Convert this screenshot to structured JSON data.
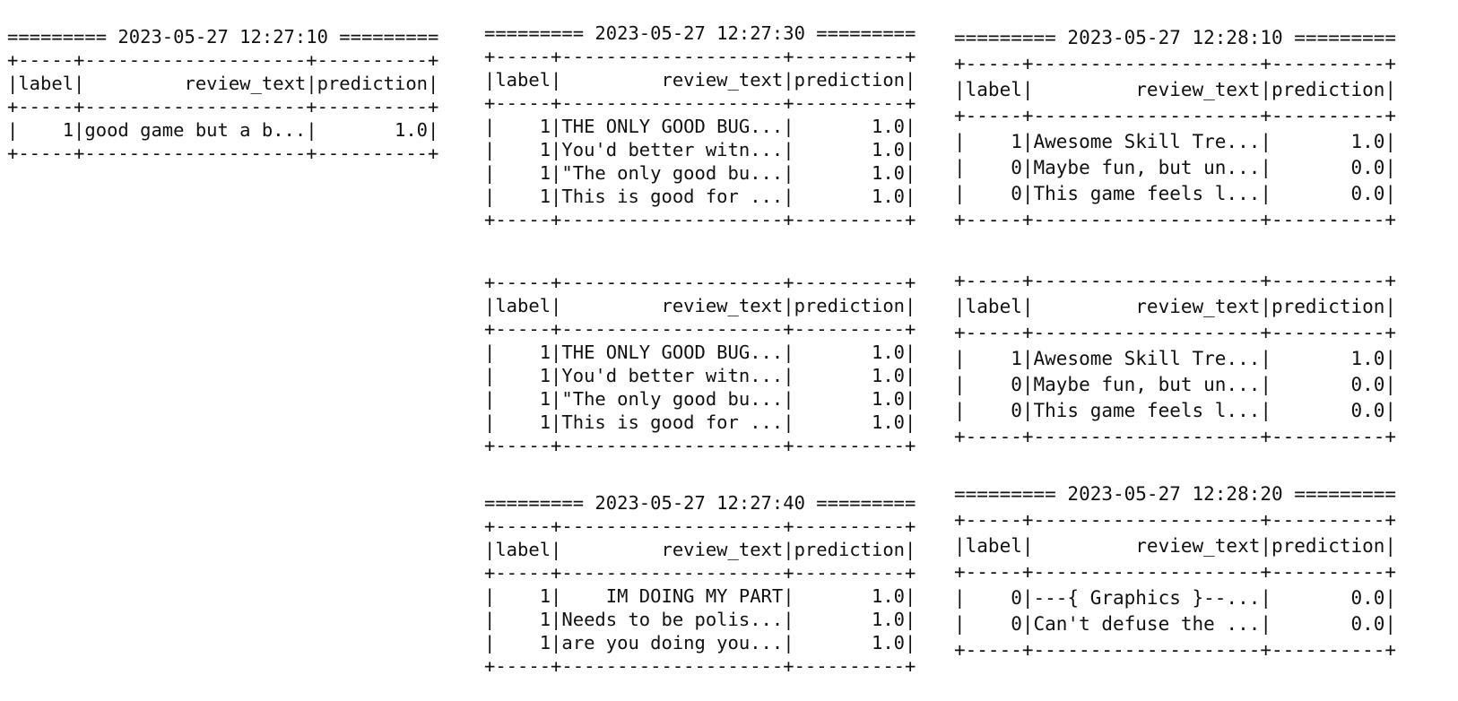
{
  "batches": {
    "b1": {
      "lines": [
        "========= 2023-05-27 12:27:10 =========",
        "+-----+--------------------+----------+",
        "|label|         review_text|prediction|",
        "+-----+--------------------+----------+",
        "|    1|good game but a b...|       1.0|",
        "+-----+--------------------+----------+"
      ]
    },
    "b2": {
      "lines": [
        "========= 2023-05-27 12:27:30 =========",
        "+-----+--------------------+----------+",
        "|label|         review_text|prediction|",
        "+-----+--------------------+----------+",
        "|    1|THE ONLY GOOD BUG...|       1.0|",
        "|    1|You'd better witn...|       1.0|",
        "|    1|\"The only good bu...|       1.0|",
        "|    1|This is good for ...|       1.0|",
        "+-----+--------------------+----------+"
      ]
    },
    "b3": {
      "lines": [
        "+-----+--------------------+----------+",
        "|label|         review_text|prediction|",
        "+-----+--------------------+----------+",
        "|    1|THE ONLY GOOD BUG...|       1.0|",
        "|    1|You'd better witn...|       1.0|",
        "|    1|\"The only good bu...|       1.0|",
        "|    1|This is good for ...|       1.0|",
        "+-----+--------------------+----------+"
      ]
    },
    "b4": {
      "lines": [
        "========= 2023-05-27 12:27:40 =========",
        "+-----+--------------------+----------+",
        "|label|         review_text|prediction|",
        "+-----+--------------------+----------+",
        "|    1|    IM DOING MY PART|       1.0|",
        "|    1|Needs to be polis...|       1.0|",
        "|    1|are you doing you...|       1.0|",
        "+-----+--------------------+----------+"
      ]
    },
    "b5": {
      "lines": [
        "========= 2023-05-27 12:28:10 =========",
        "+-----+--------------------+----------+",
        "|label|         review_text|prediction|",
        "+-----+--------------------+----------+",
        "|    1|Awesome Skill Tre...|       1.0|",
        "|    0|Maybe fun, but un...|       0.0|",
        "|    0|This game feels l...|       0.0|",
        "+-----+--------------------+----------+"
      ]
    },
    "b6": {
      "lines": [
        "+-----+--------------------+----------+",
        "|label|         review_text|prediction|",
        "+-----+--------------------+----------+",
        "|    1|Awesome Skill Tre...|       1.0|",
        "|    0|Maybe fun, but un...|       0.0|",
        "|    0|This game feels l...|       0.0|",
        "+-----+--------------------+----------+"
      ]
    },
    "b7": {
      "lines": [
        "========= 2023-05-27 12:28:20 =========",
        "+-----+--------------------+----------+",
        "|label|         review_text|prediction|",
        "+-----+--------------------+----------+",
        "|    0|---{ Graphics }--...|       0.0|",
        "|    0|Can't defuse the ...|       0.0|",
        "+-----+--------------------+----------+"
      ]
    }
  }
}
